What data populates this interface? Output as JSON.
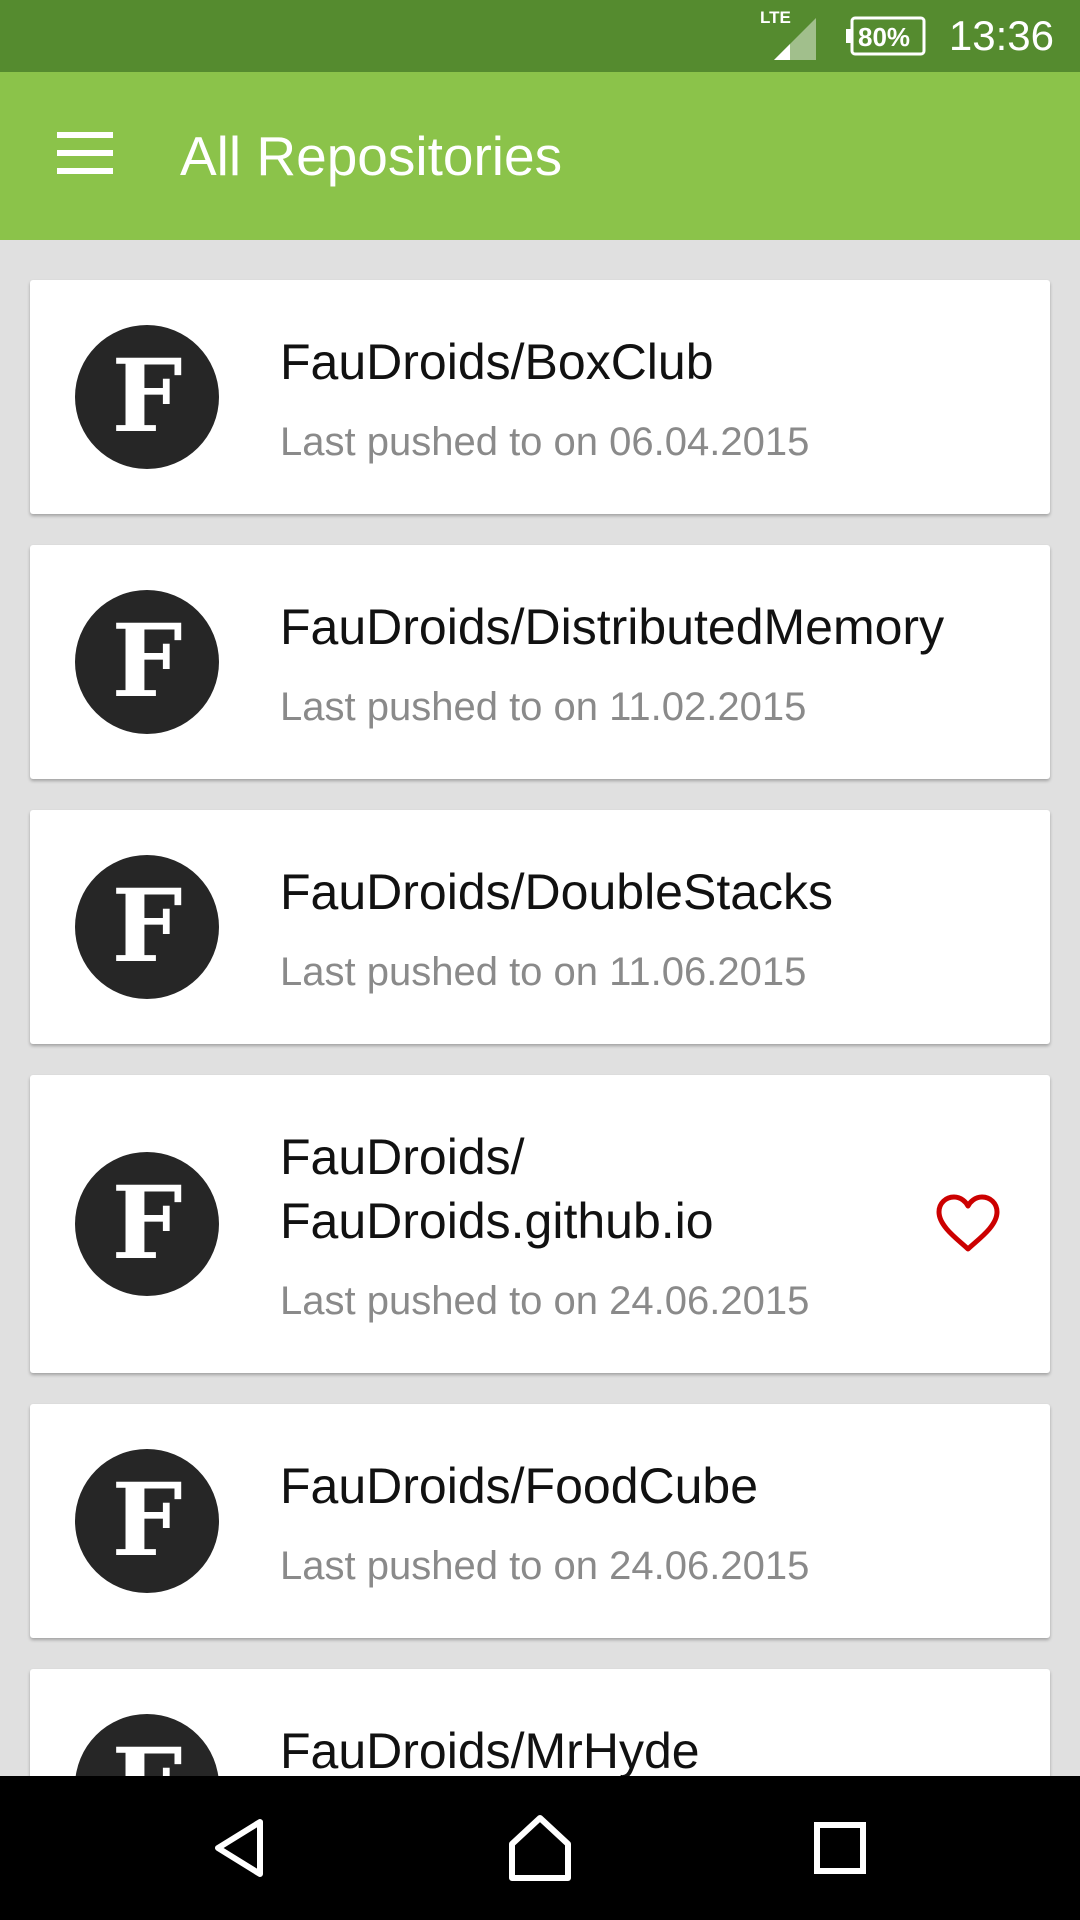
{
  "status_bar": {
    "network": "LTE",
    "battery": "80%",
    "time": "13:36"
  },
  "app_bar": {
    "title": "All Repositories",
    "menu_icon": "hamburger-menu-icon"
  },
  "repositories": [
    {
      "name": "FauDroids/BoxClub",
      "subtitle": "Last pushed to on 06.04.2015",
      "favorite": false
    },
    {
      "name": "FauDroids/DistributedMemory",
      "subtitle": "Last pushed to on 11.02.2015",
      "favorite": false
    },
    {
      "name": "FauDroids/DoubleStacks",
      "subtitle": "Last pushed to on 11.06.2015",
      "favorite": false
    },
    {
      "name_line1": "FauDroids/",
      "name_line2": "FauDroids.github.io",
      "subtitle": "Last pushed to on 24.06.2015",
      "favorite": true
    },
    {
      "name": "FauDroids/FoodCube",
      "subtitle": "Last pushed to on 24.06.2015",
      "favorite": false
    },
    {
      "name": "FauDroids/MrHyde"
    }
  ],
  "avatar_letter": "F",
  "colors": {
    "status_bar": "#558b2f",
    "app_bar": "#8bc34a",
    "background": "#e0e0e0",
    "favorite": "#cc0000"
  },
  "nav_bar": {
    "back_icon": "back-icon",
    "home_icon": "home-icon",
    "recents_icon": "recents-icon"
  }
}
